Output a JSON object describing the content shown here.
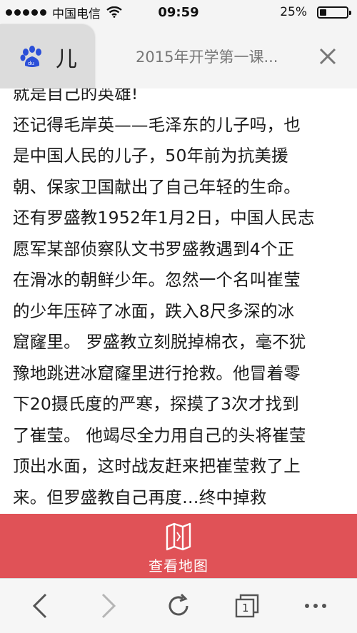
{
  "status_bar": {
    "carrier": "中国电信",
    "time": "09:59",
    "battery": "25%",
    "battery_level": 0.25
  },
  "tabs": {
    "front_tab_title": "儿",
    "active_tab_title": "2015年开学第一课..."
  },
  "article": {
    "lines": [
      "就是自己的英雄!",
      "还记得毛岸英——毛泽东的儿子吗，也",
      "是中国人民的儿子，50年前为抗美援",
      "朝、保家卫国献出了自己年轻的生命。",
      "还有罗盛教1952年1月2日，中国人民志",
      "愿军某部侦察队文书罗盛教遇到4个正",
      "在滑冰的朝鲜少年。忽然一个名叫崔莹",
      "的少年压碎了冰面，跌入8尺多深的冰",
      "窟窿里。 罗盛教立刻脱掉棉衣，毫不犹",
      "豫地跳进冰窟窿里进行抢救。他冒着零",
      "下20摄氏度的严寒，探摸了3次才找到",
      "了崔莹。 他竭尽全力用自己的头将崔莹",
      "顶出水面，这时战友赶来把崔莹救了上",
      "来。但罗盛教自己再度…终中掉救"
    ]
  },
  "map_bar": {
    "label": "查看地图",
    "color": "#e05257"
  },
  "toolbar": {
    "tab_count": "1",
    "icons": [
      "back-icon",
      "forward-icon",
      "reload-icon",
      "tabs-icon",
      "more-icon"
    ]
  }
}
